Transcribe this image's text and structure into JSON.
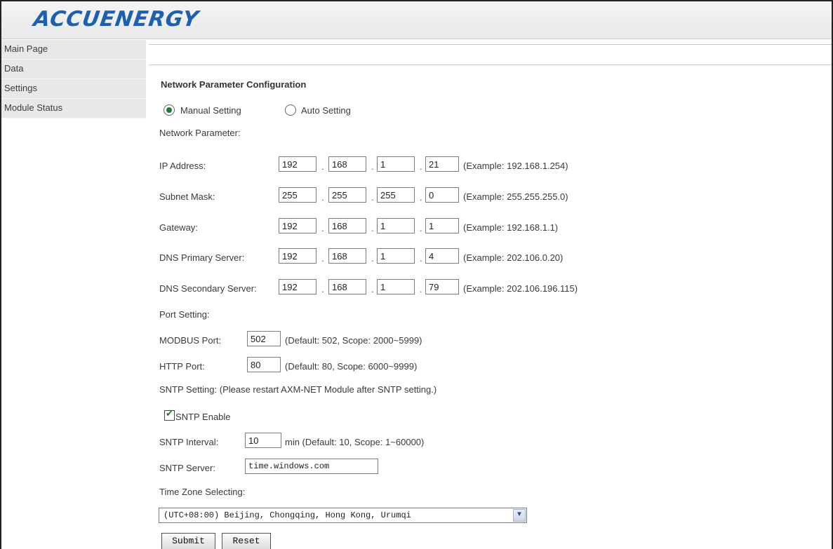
{
  "header": {
    "logo_text": "ACCUENERGY"
  },
  "sidebar": {
    "items": [
      {
        "label": "Main Page"
      },
      {
        "label": "Data"
      },
      {
        "label": "Settings"
      },
      {
        "label": "Module Status"
      }
    ]
  },
  "main": {
    "title": "Network Parameter Configuration",
    "mode": {
      "manual_label": "Manual Setting",
      "auto_label": "Auto Setting",
      "selected": "manual"
    },
    "network_section_label": "Network Parameter:",
    "network_rows": [
      {
        "label": "IP Address:",
        "octets": [
          "192",
          "168",
          "1",
          "21"
        ],
        "example": "(Example: 192.168.1.254)"
      },
      {
        "label": "Subnet Mask:",
        "octets": [
          "255",
          "255",
          "255",
          "0"
        ],
        "example": "(Example: 255.255.255.0)"
      },
      {
        "label": "Gateway:",
        "octets": [
          "192",
          "168",
          "1",
          "1"
        ],
        "example": "(Example: 192.168.1.1)"
      },
      {
        "label": "DNS Primary Server:",
        "octets": [
          "192",
          "168",
          "1",
          "4"
        ],
        "example": "(Example: 202.106.0.20)"
      },
      {
        "label": "DNS Secondary Server:",
        "octets": [
          "192",
          "168",
          "1",
          "79"
        ],
        "example": "(Example: 202.106.196.115)"
      }
    ],
    "octet_separator": ".",
    "port_section_label": "Port Setting:",
    "modbus": {
      "label": "MODBUS Port:",
      "value": "502",
      "hint": "(Default: 502, Scope: 2000~5999)"
    },
    "http": {
      "label": "HTTP Port:",
      "value": "80",
      "hint": "(Default: 80, Scope: 6000~9999)"
    },
    "sntp_section_label": "SNTP Setting: (Please restart AXM-NET Module after SNTP setting.)",
    "sntp_enable_label": "SNTP Enable",
    "sntp_enabled": true,
    "sntp_interval": {
      "label": "SNTP Interval:",
      "value": "10",
      "hint": "min (Default: 10, Scope: 1~60000)"
    },
    "sntp_server": {
      "label": "SNTP Server:",
      "value": "time.windows.com"
    },
    "timezone_label": "Time Zone Selecting:",
    "timezone_value": "(UTC+08:00) Beijing, Chongqing, Hong Kong, Urumqi",
    "submit_label": "Submit",
    "reset_label": "Reset"
  },
  "colors": {
    "logo": "#1e5fb0",
    "sidebar_bg": "#e8e8e8",
    "radio_check": "#1f7a2e"
  },
  "icons": {
    "radio_selected": "radio-selected-icon",
    "radio_unselected": "radio-unselected-icon",
    "check": "checkmark-icon",
    "dropdown": "chevron-down-icon"
  }
}
